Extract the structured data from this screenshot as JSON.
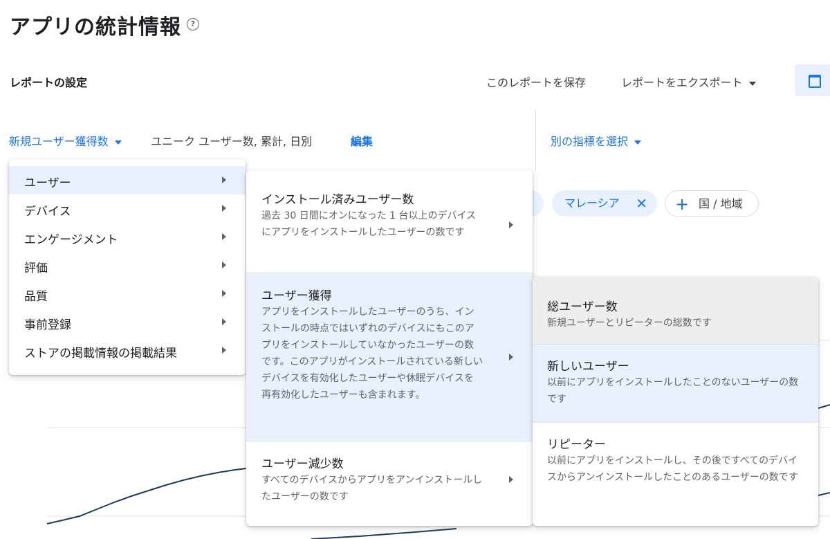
{
  "page": {
    "title": "アプリの統計情報",
    "help_icon": "?"
  },
  "toolbar": {
    "settings_label": "レポートの設定",
    "save_label": "このレポートを保存",
    "export_label": "レポートをエクスポート",
    "date_icon": "calendar-icon"
  },
  "metric_bar": {
    "selected_metric": "新規ユーザー獲得数",
    "metric_details": "ユニーク ユーザー数, 累計, 日別",
    "edit_label": "編集",
    "compare_label": "別の指標を選択"
  },
  "filters": {
    "country_chip": "マレーシア",
    "add_filter_label": "国 / 地域"
  },
  "menu_level1": {
    "items": [
      {
        "label": "ユーザー"
      },
      {
        "label": "デバイス"
      },
      {
        "label": "エンゲージメント"
      },
      {
        "label": "評価"
      },
      {
        "label": "品質"
      },
      {
        "label": "事前登録"
      },
      {
        "label": "ストアの掲載情報の掲載結果"
      }
    ]
  },
  "menu_level2": {
    "items": [
      {
        "title": "インストール済みユーザー数",
        "desc": "過去 30 日間にオンになった 1 台以上のデバイスにアプリをインストールしたユーザーの数です"
      },
      {
        "title": "ユーザー獲得",
        "desc": "アプリをインストールしたユーザーのうち、インストールの時点ではいずれのデバイスにもこのアプリをインストールしていなかったユーザーの数です。このアプリがインストールされている新しいデバイスを有効化したユーザーや休眠デバイスを再有効化したユーザーも含まれます。"
      },
      {
        "title": "ユーザー減少数",
        "desc": "すべてのデバイスからアプリをアンインストールしたユーザーの数です"
      }
    ]
  },
  "menu_level3": {
    "items": [
      {
        "title": "総ユーザー数",
        "desc": "新規ユーザーとリピーターの総数です"
      },
      {
        "title": "新しいユーザー",
        "desc": "以前にアプリをインストールしたことのないユーザーの数です"
      },
      {
        "title": "リピーター",
        "desc": "以前にアプリをインストールし、その後ですべてのデバイスからアンインストールしたことのあるユーザーの数です"
      }
    ]
  },
  "colors": {
    "accent": "#1a73e8",
    "chip_bg": "#e8f0fe",
    "line": "#1f3a5f"
  }
}
